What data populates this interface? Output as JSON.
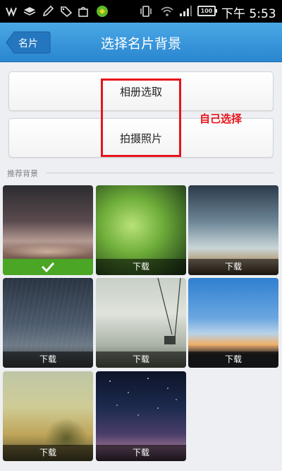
{
  "status_bar": {
    "time": "下午 5:53",
    "battery": "100",
    "icons": [
      "weibo-icon",
      "layers-icon",
      "pencil-icon",
      "tag-icon",
      "bag-icon",
      "app-icon",
      "vibrate-icon",
      "wifi-icon",
      "signal-icon",
      "battery-icon"
    ]
  },
  "header": {
    "back_label": "名片",
    "title": "选择名片背景"
  },
  "actions": {
    "album_label": "相册选取",
    "camera_label": "拍摄照片"
  },
  "annotation": {
    "text": "自己选择",
    "color": "#e8141c"
  },
  "section": {
    "label": "推荐背景"
  },
  "backgrounds": [
    {
      "selected": true,
      "label": ""
    },
    {
      "selected": false,
      "label": "下载"
    },
    {
      "selected": false,
      "label": "下载"
    },
    {
      "selected": false,
      "label": "下载"
    },
    {
      "selected": false,
      "label": "下载"
    },
    {
      "selected": false,
      "label": "下载"
    },
    {
      "selected": false,
      "label": "下载"
    },
    {
      "selected": false,
      "label": "下载"
    }
  ],
  "colors": {
    "titlebar": "#2a86cf",
    "selected_bar": "#4aa624"
  }
}
